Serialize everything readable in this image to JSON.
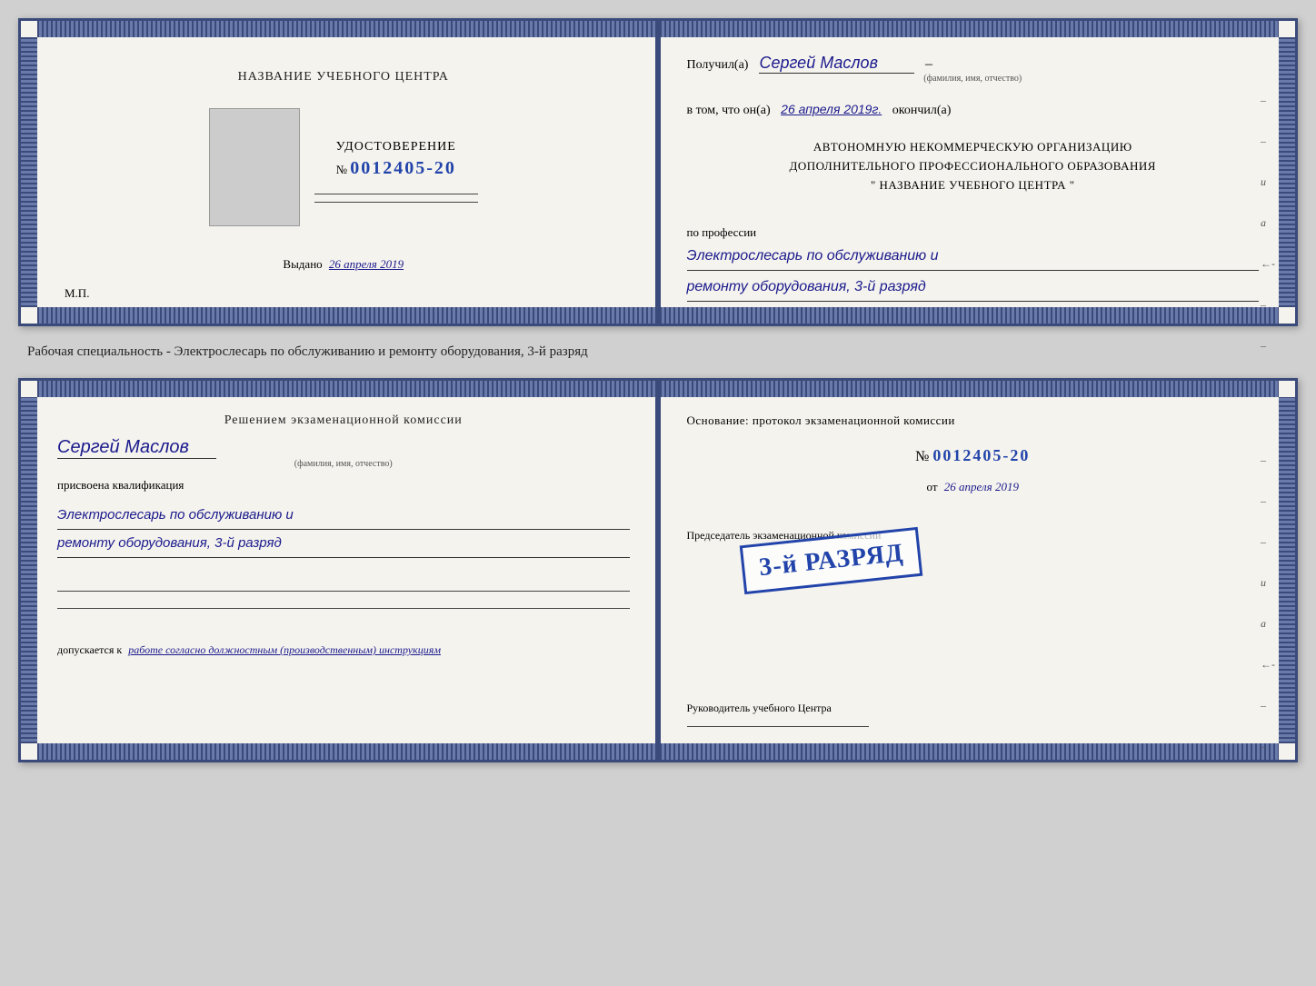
{
  "page": {
    "background": "#d0d0d0"
  },
  "top_cert": {
    "left": {
      "institution_placeholder": "НАЗВАНИЕ УЧЕБНОГО ЦЕНТРА",
      "cert_label": "УДОСТОВЕРЕНИЕ",
      "cert_number_prefix": "№",
      "cert_number": "0012405-20",
      "issued_label": "Выдано",
      "issued_date": "26 апреля 2019",
      "mp_label": "М.П."
    },
    "right": {
      "received_label": "Получил(а)",
      "recipient_name": "Сергей Маслов",
      "recipient_hint": "(фамилия, имя, отчество)",
      "dash": "–",
      "in_that_label": "в том, что он(а)",
      "completed_date": "26 апреля 2019г.",
      "finished_label": "окончил(а)",
      "org_line1": "АВТОНОМНУЮ НЕКОММЕРЧЕСКУЮ ОРГАНИЗАЦИЮ",
      "org_line2": "ДОПОЛНИТЕЛЬНОГО ПРОФЕССИОНАЛЬНОГО ОБРАЗОВАНИЯ",
      "org_line3": "\"   НАЗВАНИЕ УЧЕБНОГО ЦЕНТРА   \"",
      "profession_label": "по профессии",
      "profession_line1": "Электрослесарь по обслуживанию и",
      "profession_line2": "ремонту оборудования, 3-й разряд"
    }
  },
  "between_label": "Рабочая специальность - Электрослесарь по обслуживанию и ремонту оборудования, 3-й разряд",
  "bottom_cert": {
    "left": {
      "decision_label": "Решением экзаменационной комиссии",
      "person_name": "Сергей Маслов",
      "person_hint": "(фамилия, имя, отчество)",
      "assigned_label": "присвоена квалификация",
      "qualification_line1": "Электрослесарь по обслуживанию и",
      "qualification_line2": "ремонту оборудования, 3-й разряд",
      "admitted_label": "допускается к",
      "admitted_text": "работе согласно должностным (производственным) инструкциям"
    },
    "right": {
      "osnov_label": "Основание: протокол экзаменационной комиссии",
      "number_prefix": "№",
      "number": "0012405-20",
      "from_label": "от",
      "from_date": "26 апреля 2019",
      "chairman_label": "Председатель экзаменационной комиссии",
      "stamp_text": "3-й РАЗРЯД",
      "manager_label": "Руководитель учебного Центра"
    }
  }
}
